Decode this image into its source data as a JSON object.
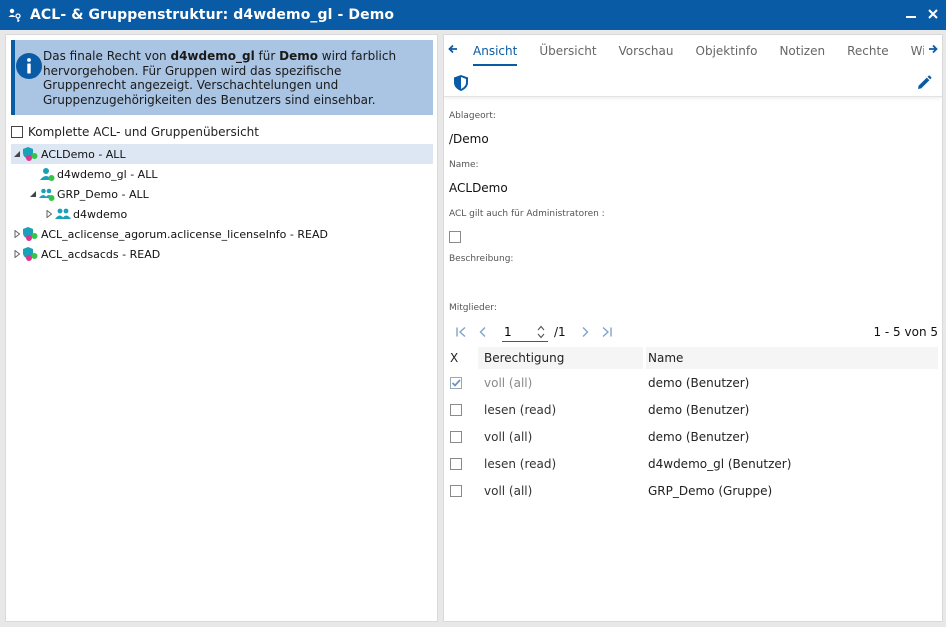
{
  "window": {
    "title": "ACL- & Gruppenstruktur: d4wdemo_gl - Demo",
    "title_icon": "acl-structure-icon",
    "minimize_icon": "minimize-icon",
    "close_icon": "close-icon"
  },
  "info": {
    "part1": "Das finale Recht von ",
    "user": "d4wdemo_gl",
    "part2": " für ",
    "object": "Demo",
    "part3": " wird farblich hervorgehoben. Für Gruppen wird das spezifische Gruppenrecht angezeigt. Verschachtelungen und Gruppenzugehörigkeiten des Benutzers sind einsehbar.",
    "icon": "info-icon"
  },
  "overview_label": "Komplette ACL- und Gruppenübersicht",
  "tree": [
    {
      "label": "ACLDemo - ALL",
      "type": "acl",
      "toggle": "expanded",
      "selected": true
    },
    {
      "label": "d4wdemo_gl - ALL",
      "type": "user",
      "toggle": "none"
    },
    {
      "label": "GRP_Demo - ALL",
      "type": "group",
      "toggle": "expanded"
    },
    {
      "label": "d4wdemo",
      "type": "group-plain",
      "toggle": "collapsed"
    },
    {
      "label": "ACL_aclicense_agorum.aclicense_licenseInfo - READ",
      "type": "acl",
      "toggle": "collapsed"
    },
    {
      "label": "ACL_acdsacds - READ",
      "type": "acl",
      "toggle": "collapsed"
    }
  ],
  "tabs": [
    "Ansicht",
    "Übersicht",
    "Vorschau",
    "Objektinfo",
    "Notizen",
    "Rechte",
    "Wiede"
  ],
  "active_tab": "Ansicht",
  "form": {
    "location_label": "Ablageort:",
    "location_value": "/Demo",
    "name_label": "Name:",
    "name_value": "ACLDemo",
    "admin_label": "ACL gilt auch für Administratoren :",
    "description_label": "Beschreibung:",
    "members_label": "Mitglieder:"
  },
  "pager": {
    "page": "1",
    "total": "/1",
    "count": "1 - 5 von 5"
  },
  "grid": {
    "headers": [
      "X",
      "Berechtigung",
      "Name"
    ],
    "rows": [
      {
        "checked": true,
        "permission": "voll (all)",
        "name": "demo (Benutzer)"
      },
      {
        "checked": false,
        "permission": "lesen (read)",
        "name": "demo (Benutzer)"
      },
      {
        "checked": false,
        "permission": "voll (all)",
        "name": "demo (Benutzer)"
      },
      {
        "checked": false,
        "permission": "lesen (read)",
        "name": "d4wdemo_gl (Benutzer)"
      },
      {
        "checked": false,
        "permission": "voll (all)",
        "name": "GRP_Demo (Gruppe)"
      }
    ]
  },
  "colors": {
    "accent": "#0a5ba6",
    "info_bg": "#aac4e3",
    "selected_row": "#dde7f3"
  }
}
